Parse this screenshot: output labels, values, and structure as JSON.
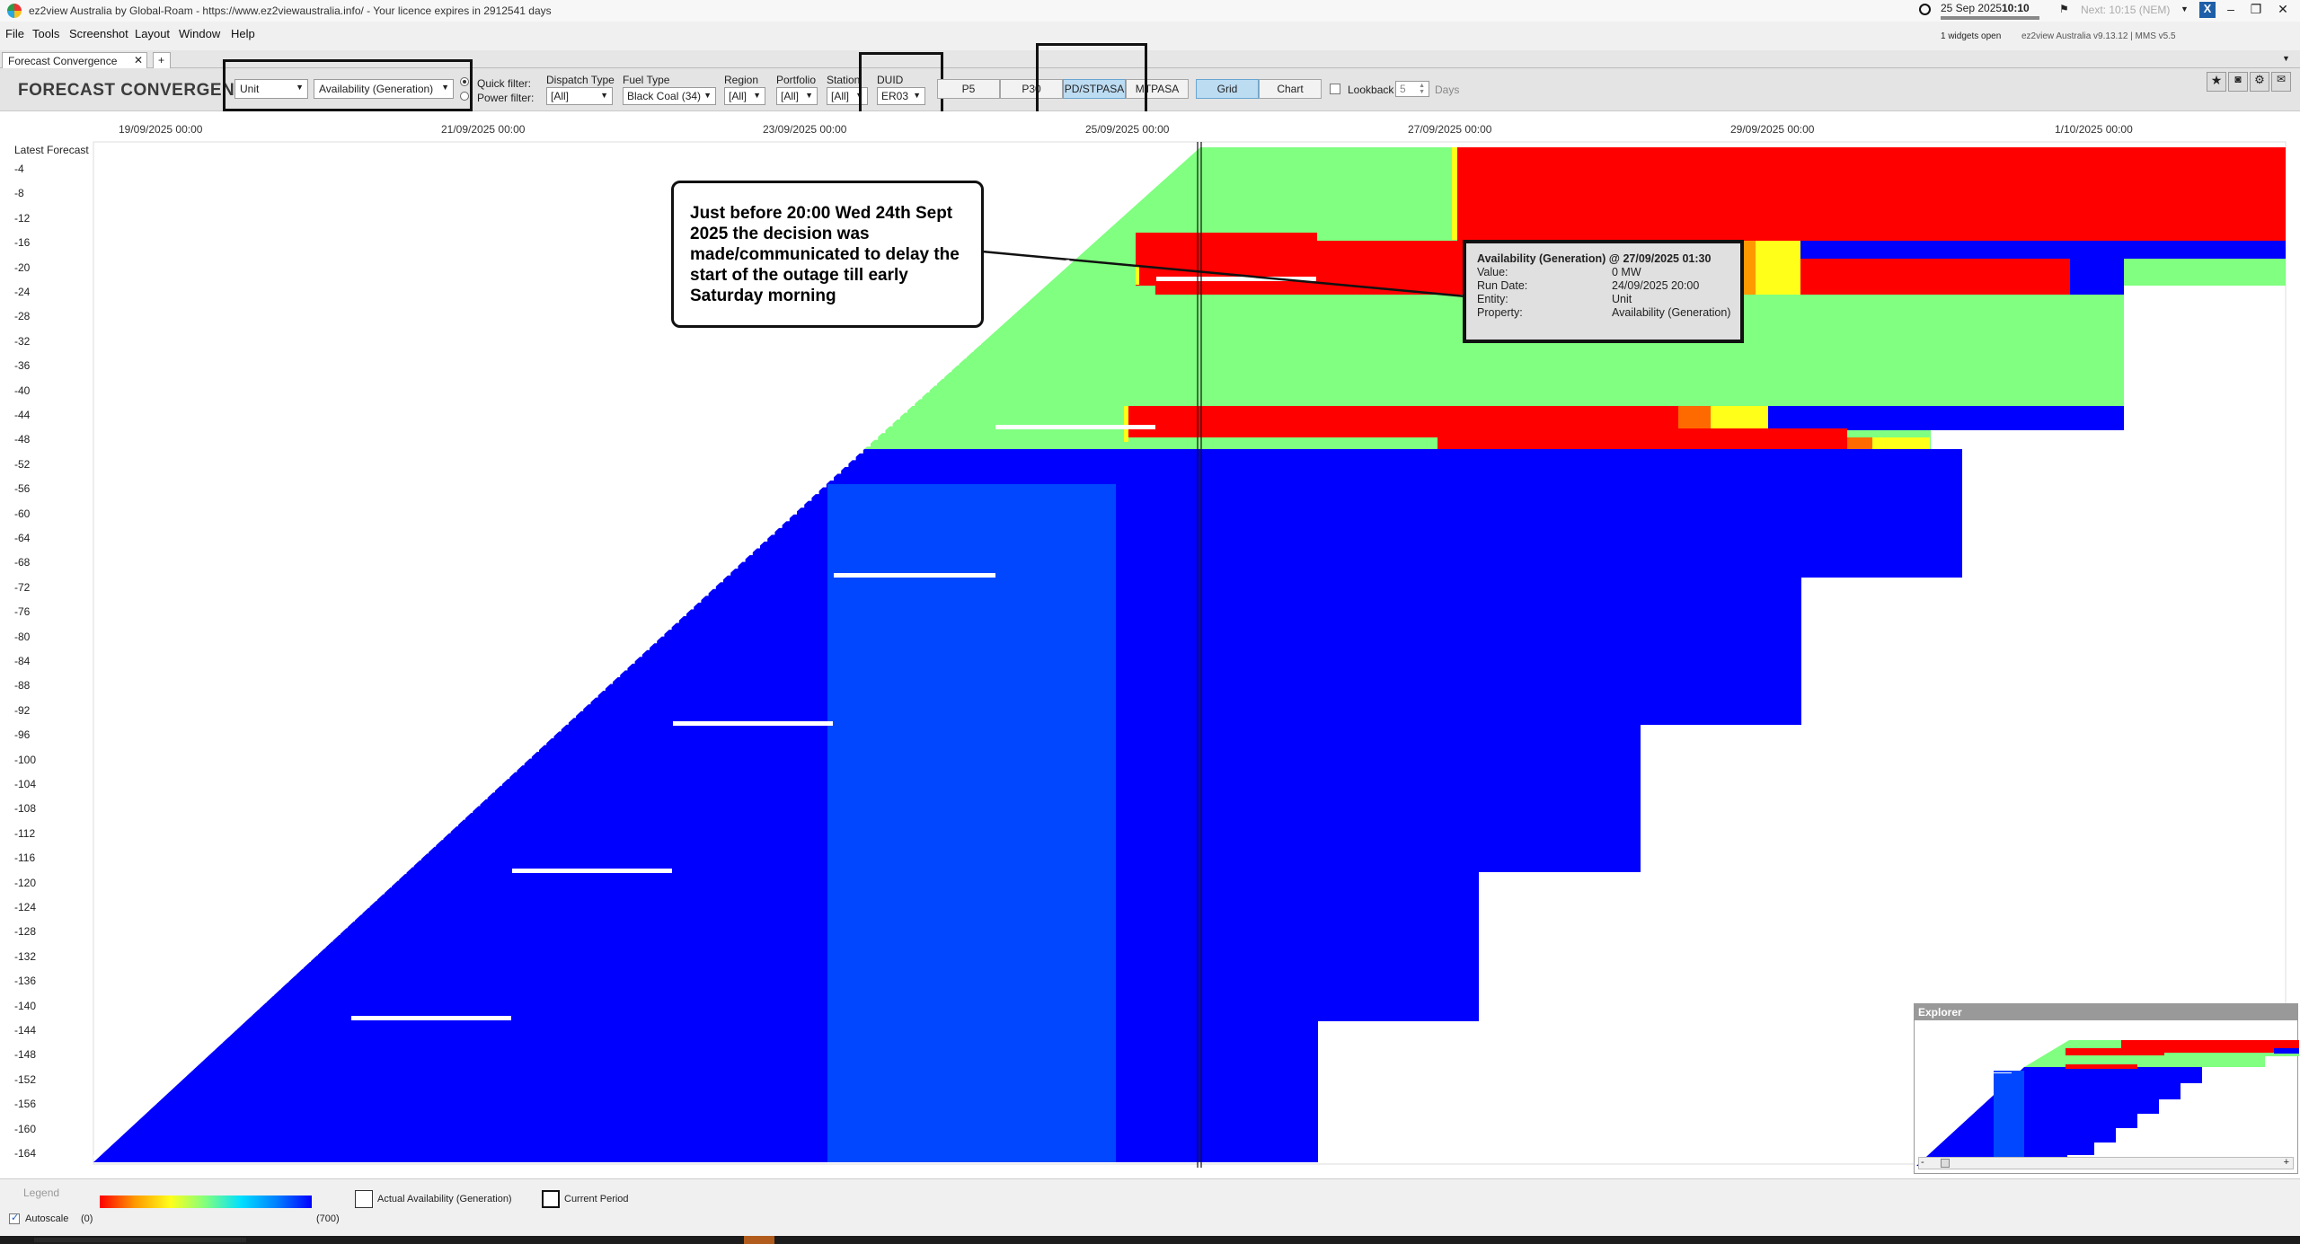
{
  "window": {
    "title": "ez2view Australia by Global-Roam - https://www.ez2viewaustralia.info/ - Your licence expires in 2912541 days",
    "clock_date": "25 Sep 2025",
    "clock_time": "10:10",
    "next_label": "Next: 10:15 (NEM)",
    "widgets_open": "1 widgets open",
    "version": "ez2view Australia v9.13.12 | MMS v5.5"
  },
  "menu": [
    "File",
    "Tools",
    "Screenshot",
    "Layout",
    "Window",
    "Help"
  ],
  "tabs": {
    "active": "Forecast Convergence",
    "add": "+"
  },
  "toolbar": {
    "title": "FORECAST CONVERGENCE",
    "unit_select": "Unit",
    "property_select": "Availability (Generation)",
    "quick_filter": "Quick filter:",
    "power_filter": "Power filter:",
    "dispatch_type_label": "Dispatch Type",
    "dispatch_type_value": "[All]",
    "fuel_type_label": "Fuel Type",
    "fuel_type_value": "Black Coal (34)",
    "region_label": "Region",
    "region_value": "[All]",
    "portfolio_label": "Portfolio",
    "portfolio_value": "[All]",
    "station_label": "Station",
    "station_value": "[All]",
    "duid_label": "DUID",
    "duid_value": "ER03",
    "btn_p5": "P5",
    "btn_p30": "P30",
    "btn_pdstpasa": "PD/STPASA",
    "btn_mtpasa": "MTPASA",
    "btn_grid": "Grid",
    "btn_chart": "Chart",
    "lookback_label": "Lookback",
    "lookback_value": "5",
    "days_label": "Days"
  },
  "chart": {
    "x_axis_dates": [
      "19/09/2025 00:00",
      "21/09/2025 00:00",
      "23/09/2025 00:00",
      "25/09/2025 00:00",
      "27/09/2025 00:00",
      "29/09/2025 00:00",
      "1/10/2025 00:00"
    ],
    "y_axis_header": "Latest Forecast",
    "y_axis_ticks": [
      "-4",
      "-8",
      "-12",
      "-16",
      "-20",
      "-24",
      "-28",
      "-32",
      "-36",
      "-40",
      "-44",
      "-48",
      "-52",
      "-56",
      "-60",
      "-64",
      "-68",
      "-72",
      "-76",
      "-80",
      "-84",
      "-88",
      "-92",
      "-96",
      "-100",
      "-104",
      "-108",
      "-112",
      "-116",
      "-120",
      "-124",
      "-128",
      "-132",
      "-136",
      "-140",
      "-144",
      "-148",
      "-152",
      "-156",
      "-160",
      "-164"
    ],
    "colors": {
      "high": "#0000ff",
      "mid": "#0047ff",
      "green": "#80ff80",
      "red": "#ff0000",
      "orange": "#ff6a00",
      "yellow": "#ffff1a"
    }
  },
  "annotation": {
    "text": "Just before 20:00 Wed 24th Sept 2025 the decision was made/communicated to delay the start of the outage till early Saturday morning"
  },
  "tooltip": {
    "title": "Availability (Generation) @ 27/09/2025 01:30",
    "rows": [
      {
        "label": "Value:",
        "value": "0 MW"
      },
      {
        "label": "Run Date:",
        "value": "24/09/2025 20:00"
      },
      {
        "label": "Entity:",
        "value": "Unit"
      },
      {
        "label": "Property:",
        "value": "Availability (Generation)"
      }
    ]
  },
  "explorer": {
    "title": "Explorer"
  },
  "legend": {
    "title": "Legend",
    "min": "(0)",
    "max": "(700)",
    "autoscale": "Autoscale",
    "actual_label": "Actual Availability (Generation)",
    "current_label": "Current Period"
  }
}
